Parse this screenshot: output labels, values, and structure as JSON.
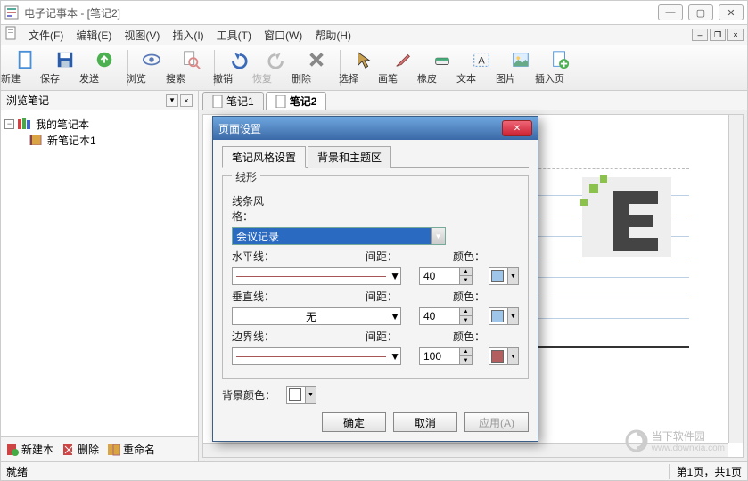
{
  "window": {
    "title": "电子记事本 - [笔记2]"
  },
  "menus": {
    "file": "文件(F)",
    "edit": "编辑(E)",
    "view": "视图(V)",
    "insert": "插入(I)",
    "tools": "工具(T)",
    "window": "窗口(W)",
    "help": "帮助(H)"
  },
  "toolbar": {
    "new": "新建",
    "save": "保存",
    "send": "发送",
    "browse": "浏览",
    "search": "搜索",
    "undo": "撤销",
    "redo": "恢复",
    "delete": "删除",
    "select": "选择",
    "pen": "画笔",
    "eraser": "橡皮",
    "text": "文本",
    "image": "图片",
    "insert_page": "插入页"
  },
  "sidebar": {
    "title": "浏览笔记",
    "root": "我的笔记本",
    "child1": "新笔记本1",
    "new_book": "新建本",
    "delete": "删除",
    "rename": "重命名"
  },
  "tabs": {
    "t1": "笔记1",
    "t2": "笔记2"
  },
  "dialog": {
    "title": "页面设置",
    "tab1": "笔记风格设置",
    "tab2": "背景和主题区",
    "group_lines": "线形",
    "line_style_label": "线条风格：",
    "line_style_value": "会议记录",
    "horiz_label": "水平线：",
    "horiz_spacing": "40",
    "vert_label": "垂直线：",
    "vert_value": "无",
    "vert_spacing": "40",
    "border_label": "边界线：",
    "border_spacing": "100",
    "spacing_label": "间距：",
    "color_label": "颜色：",
    "bg_color_label": "背景颜色：",
    "ok": "确定",
    "cancel": "取消",
    "apply": "应用(A)",
    "colors": {
      "horiz": "#9fc5e8",
      "vert": "#9fc5e8",
      "border": "#b45f5f",
      "bg": "#ffffff"
    }
  },
  "status": {
    "ready": "就绪",
    "page": "第1页，共1页"
  },
  "watermark": {
    "text": "当下软件园",
    "url": "www.downxia.com"
  }
}
